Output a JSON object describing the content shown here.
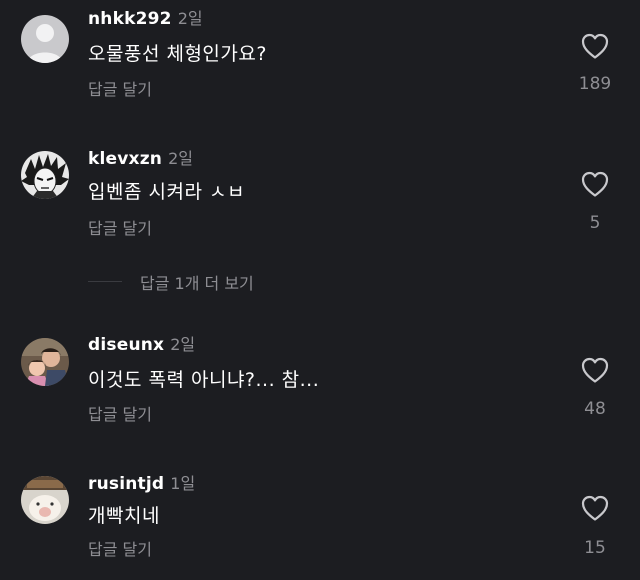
{
  "comments": [
    {
      "username": "nhkk292",
      "time": "2일",
      "text": "오물풍선 체형인가요?",
      "reply_label": "답글 달기",
      "likes": "189",
      "avatar": "default-avatar-icon"
    },
    {
      "username": "klevxzn",
      "time": "2일",
      "text": "입벤좀 시켜라 ㅅㅂ",
      "reply_label": "답글 달기",
      "likes": "5",
      "avatar": "manga-character-avatar"
    },
    {
      "username": "diseunx",
      "time": "2일",
      "text": "이것도 폭력 아니냐?... 참...",
      "reply_label": "답글 달기",
      "likes": "48",
      "avatar": "photo-avatar"
    },
    {
      "username": "rusintjd",
      "time": "1일",
      "text": "개빡치네",
      "reply_label": "답글 달기",
      "likes": "15",
      "avatar": "pet-avatar"
    }
  ],
  "more_replies": {
    "label": "답글 1개 더 보기"
  },
  "colors": {
    "background": "#1c1d21",
    "primary_text": "#ffffff",
    "secondary_text": "#8e8e93"
  },
  "icons": {
    "like": "heart-outline-icon"
  }
}
